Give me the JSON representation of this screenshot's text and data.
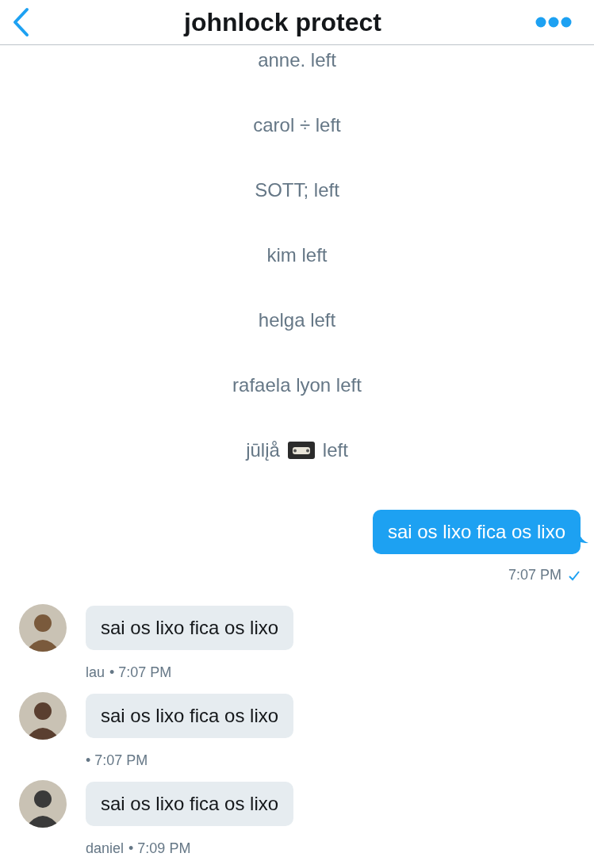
{
  "header": {
    "title": "johnlock protect"
  },
  "events": [
    {
      "kind": "plain",
      "text": "anne. left"
    },
    {
      "kind": "plain",
      "text": "carol ÷ left"
    },
    {
      "kind": "plain",
      "text": "SOTT; left"
    },
    {
      "kind": "plain",
      "text": "kim left"
    },
    {
      "kind": "plain",
      "text": "helga left"
    },
    {
      "kind": "plain",
      "text": "rafaela lyon left"
    },
    {
      "kind": "with-icon",
      "text": "jūlįå",
      "after": "left"
    }
  ],
  "sent": {
    "text": "sai os lixo fica os lixo",
    "time": "7:07 PM"
  },
  "received": [
    {
      "text": "sai os lixo fica os lixo",
      "sender": "lau",
      "time": "• 7:07 PM",
      "color": "#7a5a3c"
    },
    {
      "text": "sai os lixo fica os lixo",
      "time": "• 7:07 PM",
      "color": "#5a3f30"
    },
    {
      "text": "sai os lixo fica os lixo",
      "sender": "daniel",
      "time": "• 7:09 PM",
      "color": "#3a3a3a"
    }
  ]
}
